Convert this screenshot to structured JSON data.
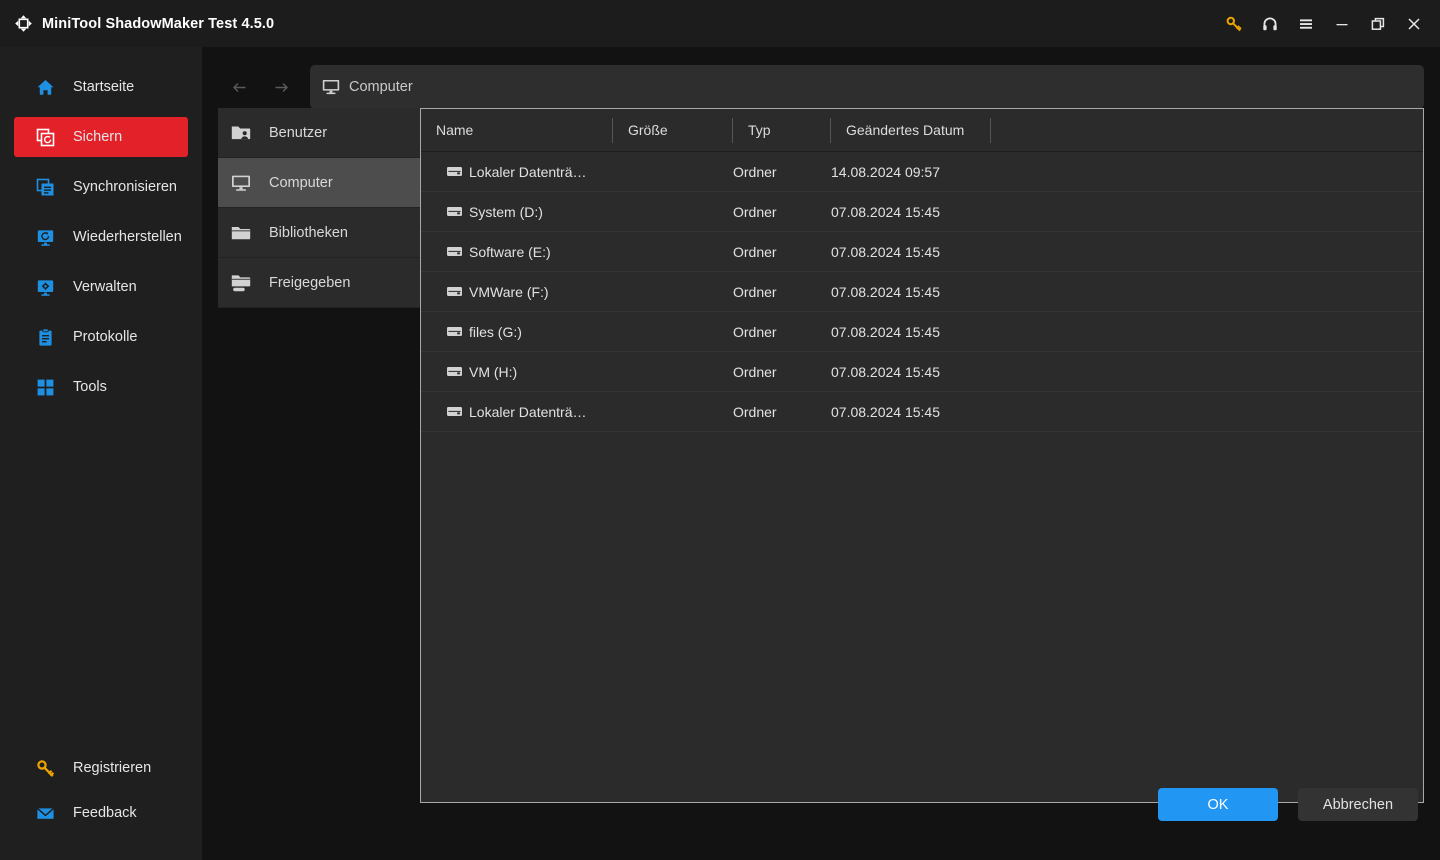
{
  "window": {
    "title": "MiniTool ShadowMaker Test 4.5.0",
    "logo_icon": "shadowmaker-logo-icon",
    "controls": [
      {
        "name": "key-icon",
        "glyph": "key",
        "color": "#eba300"
      },
      {
        "name": "headphones-icon",
        "glyph": "headset",
        "color": "#e6e6e6"
      },
      {
        "name": "menu-icon",
        "glyph": "hamburger",
        "color": "#e6e6e6"
      },
      {
        "name": "minimize-icon",
        "glyph": "minimize",
        "color": "#e6e6e6"
      },
      {
        "name": "restore-icon",
        "glyph": "restore",
        "color": "#e6e6e6"
      },
      {
        "name": "close-icon",
        "glyph": "close",
        "color": "#e6e6e6"
      }
    ]
  },
  "sidebar": {
    "items": [
      {
        "label": "Startseite",
        "icon": "home-icon",
        "active": false
      },
      {
        "label": "Sichern",
        "icon": "backup-icon",
        "active": true
      },
      {
        "label": "Synchronisieren",
        "icon": "sync-icon",
        "active": false
      },
      {
        "label": "Wiederherstellen",
        "icon": "restore-disk-icon",
        "active": false
      },
      {
        "label": "Verwalten",
        "icon": "manage-icon",
        "active": false
      },
      {
        "label": "Protokolle",
        "icon": "logs-icon",
        "active": false
      },
      {
        "label": "Tools",
        "icon": "tools-icon",
        "active": false
      }
    ],
    "bottom_items": [
      {
        "label": "Registrieren",
        "icon": "key-icon"
      },
      {
        "label": "Feedback",
        "icon": "mail-icon"
      }
    ],
    "active_color": "#e32129",
    "icon_color": "#1e8fe1"
  },
  "navigation": {
    "back_icon": "arrow-left-icon",
    "forward_icon": "arrow-right-icon",
    "address": {
      "icon": "computer-icon",
      "value": "Computer",
      "placeholder": "Computer"
    }
  },
  "tree": {
    "items": [
      {
        "label": "Benutzer",
        "icon": "users-folder-icon",
        "active": false
      },
      {
        "label": "Computer",
        "icon": "computer-icon",
        "active": true
      },
      {
        "label": "Bibliotheken",
        "icon": "folder-icon",
        "active": false
      },
      {
        "label": "Freigegeben",
        "icon": "shared-folder-icon",
        "active": false
      }
    ]
  },
  "filelist": {
    "columns": [
      {
        "key": "name",
        "label": "Name"
      },
      {
        "key": "size",
        "label": "Größe"
      },
      {
        "key": "type",
        "label": "Typ"
      },
      {
        "key": "date",
        "label": "Geändertes Datum"
      }
    ],
    "rows": [
      {
        "icon": "drive-icon",
        "name": "Lokaler Datenträ…",
        "size": "",
        "type": "Ordner",
        "date": "14.08.2024 09:57"
      },
      {
        "icon": "drive-icon",
        "name": "System (D:)",
        "size": "",
        "type": "Ordner",
        "date": "07.08.2024 15:45"
      },
      {
        "icon": "drive-icon",
        "name": "Software (E:)",
        "size": "",
        "type": "Ordner",
        "date": "07.08.2024 15:45"
      },
      {
        "icon": "drive-icon",
        "name": "VMWare (F:)",
        "size": "",
        "type": "Ordner",
        "date": "07.08.2024 15:45"
      },
      {
        "icon": "drive-icon",
        "name": "files (G:)",
        "size": "",
        "type": "Ordner",
        "date": "07.08.2024 15:45"
      },
      {
        "icon": "drive-icon",
        "name": "VM (H:)",
        "size": "",
        "type": "Ordner",
        "date": "07.08.2024 15:45"
      },
      {
        "icon": "drive-icon",
        "name": "Lokaler Datenträ…",
        "size": "",
        "type": "Ordner",
        "date": "07.08.2024 15:45"
      }
    ]
  },
  "footer": {
    "ok_label": "OK",
    "cancel_label": "Abbrechen",
    "ok_color": "#2196f3"
  }
}
